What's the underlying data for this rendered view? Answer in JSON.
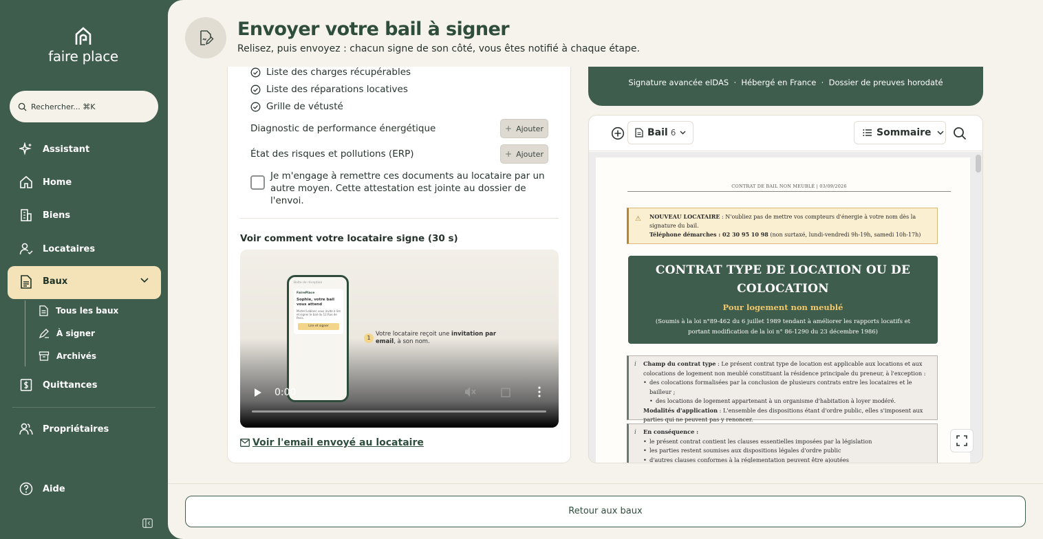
{
  "brand": {
    "name": "faire place"
  },
  "search": {
    "placeholder": "Rechercher... ⌘K"
  },
  "sidebar": {
    "items": [
      {
        "label": "Assistant",
        "icon": "sparkle-icon"
      },
      {
        "label": "Home",
        "icon": "home-icon"
      },
      {
        "label": "Biens",
        "icon": "building-icon"
      },
      {
        "label": "Locataires",
        "icon": "user-check-icon"
      },
      {
        "label": "Baux",
        "icon": "document-icon"
      },
      {
        "label": "Quittances",
        "icon": "receipt-icon"
      },
      {
        "label": "Propriétaires",
        "icon": "users-icon"
      },
      {
        "label": "Aide",
        "icon": "help-icon"
      }
    ],
    "sub_items": [
      {
        "label": "Tous les baux",
        "icon": "document-icon"
      },
      {
        "label": "À signer",
        "icon": "signature-icon"
      },
      {
        "label": "Archivés",
        "icon": "archive-icon"
      }
    ]
  },
  "header": {
    "title": "Envoyer votre bail à signer",
    "subtitle": "Relisez, puis envoyez : chacun signe de son côté, vous êtes notifié à chaque étape."
  },
  "documents": {
    "included": [
      "Liste des charges récupérables",
      "Liste des réparations locatives",
      "Grille de vétusté"
    ],
    "optional": [
      {
        "label": "Diagnostic de performance énergétique",
        "button": "Ajouter"
      },
      {
        "label": "État des risques et pollutions (ERP)",
        "button": "Ajouter"
      }
    ],
    "attestation": "Je m'engage à remettre ces documents au locataire par un autre moyen. Cette attestation est jointe au dossier de l'envoi."
  },
  "video": {
    "title": "Voir comment votre locataire signe (30 s)",
    "time": "0:00",
    "phone_inbox": "Boîte de réception",
    "phone_sender": "FairePlace",
    "phone_heading": "Sophie, votre bail vous attend",
    "phone_body": "Michel Leblanc vous invite à lire et signer le bail du 12 Rue de Paris.",
    "phone_button": "Lire et signer",
    "step_number": "1",
    "step_text_a": "Votre locataire reçoit une ",
    "step_text_b": "invitation par email",
    "step_text_c": ", à son nom."
  },
  "email_link": "Voir l'email envoyé au locataire",
  "banner": {
    "text": "Signature avancée eIDAS  ·  Hébergé en France  ·  Dossier de preuves horodaté"
  },
  "viewer": {
    "doc_label": "Bail",
    "doc_count": "6",
    "summary_label": "Sommaire"
  },
  "contract": {
    "head": "CONTRAT DE BAIL NON MEUBLÉ | 03/09/2026",
    "alert_title": "NOUVEAU LOCATAIRE",
    "alert_text": " : N'oubliez pas de mettre vos compteurs d'énergie à votre nom dès la signature du bail.",
    "alert_phone_label": "Téléphone démarches : 02 30 95 10 98",
    "alert_phone_note": " (non surtaxé, lundi-vendredi 9h-19h, samedi 10h-17h)",
    "title": "CONTRAT TYPE DE LOCATION OU DE COLOCATION",
    "subtitle": "Pour logement non meublé",
    "law": "(Soumis à la loi n°89-462 du 6 juillet 1989 tendant à améliorer les rapports locatifs et portant modification de la loi n° 86-1290 du 23 décembre 1986)",
    "scope_title": "Champ du contrat type",
    "scope_text": " : Le présent contrat type de location est applicable aux locations et aux colocations de logement non meublé constituant la résidence principale du preneur, à l'exception :",
    "scope_b1": "des colocations formalisées par la conclusion de plusieurs contrats entre les locataires et le bailleur ;",
    "scope_b2": "des locations de logement appartenant à un organisme d'habitation à loyer modéré.",
    "modal_title": "Modalités d'application",
    "modal_text": " : L'ensemble des dispositions étant d'ordre public, elles s'imposent aux parties qui ne peuvent pas y renoncer.",
    "conseq_title": "En conséquence :",
    "conseq_b1": "le présent contrat contient les clauses essentielles imposées par la législation",
    "conseq_b2": "les parties restent soumises aux dispositions légales d'ordre public",
    "conseq_b3": "d'autres clauses conformes à la réglementation peuvent être ajoutées"
  },
  "footer": {
    "back_label": "Retour aux baux"
  },
  "colors": {
    "brand_green": "#3f5d4c",
    "active_bg": "#f4e3b8",
    "accent_gold": "#f2c86b"
  }
}
